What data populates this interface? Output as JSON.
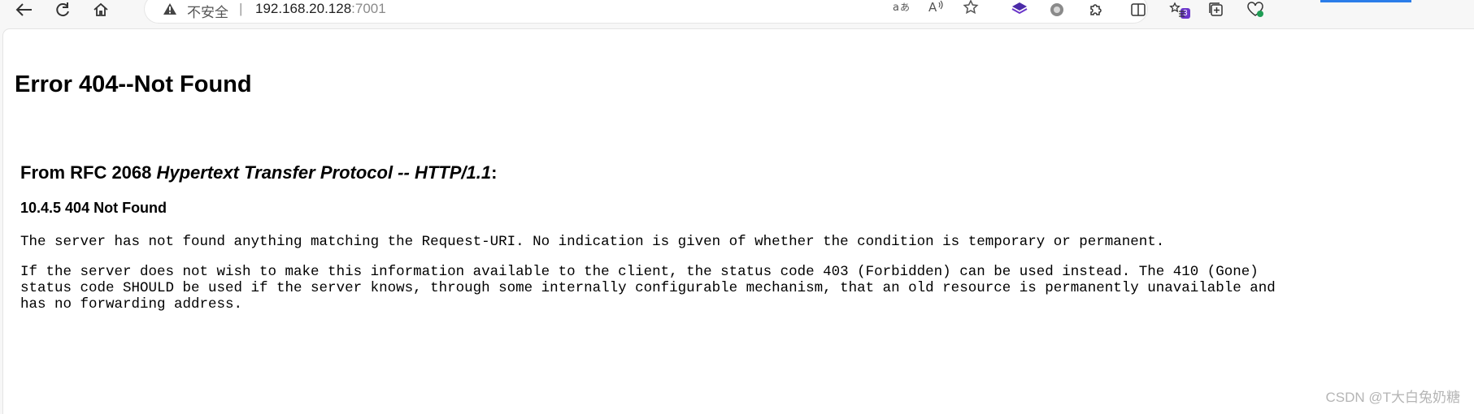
{
  "browser": {
    "address": {
      "insecure_label": "不安全",
      "separator": "|",
      "host": "192.168.20.128",
      "port": ":7001"
    },
    "extensions_badge": "3"
  },
  "page": {
    "title": "Error 404--Not Found",
    "rfc_prefix": "From RFC 2068 ",
    "rfc_title": "Hypertext Transfer Protocol -- HTTP/1.1",
    "rfc_suffix": ":",
    "section": "10.4.5 404 Not Found",
    "para1": "The server has not found anything matching the Request-URI. No indication is given of whether the condition is temporary or permanent.",
    "para2_line1": "If the server does not wish to make this information available to the client, the status code 403 (Forbidden) can be used instead. The 410 (Gone)",
    "para2_line2": "status code SHOULD be used if the server knows, through some internally configurable mechanism, that an old resource is permanently unavailable and",
    "para2_line3": "has no forwarding address."
  },
  "watermark": "CSDN @T大白兔奶糖",
  "icons": {
    "back": "back-arrow-icon",
    "reload": "reload-icon",
    "home": "home-icon",
    "warning": "warning-triangle-icon",
    "read_aloud": "read-aloud-icon",
    "translate": "translate-icon",
    "favorite": "star-icon",
    "extensions": "puzzle-icon",
    "split": "split-screen-icon",
    "favorites_list": "favorites-list-icon",
    "collections": "collections-icon",
    "health": "browser-essentials-icon"
  }
}
